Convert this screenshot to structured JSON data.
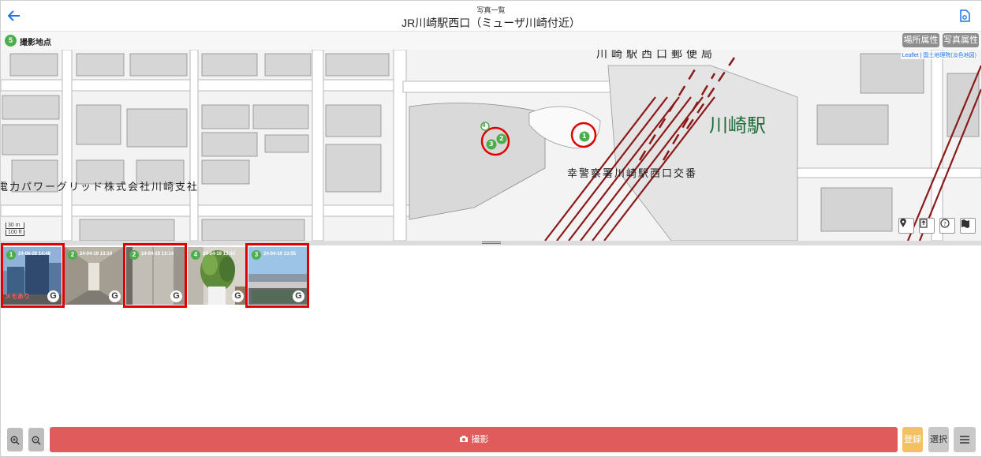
{
  "header": {
    "subtitle": "写真一覧",
    "title": "JR川崎駅西口（ミューザ川崎付近）"
  },
  "subbar": {
    "count": "5",
    "label": "撮影地点",
    "place_attr_label": "場所属性",
    "photo_attr_label": "写真属性"
  },
  "map": {
    "attribution": "Leaflet | 国土地理院(淡色地図)",
    "scale_m": "30 m",
    "scale_ft": "100 ft",
    "labels": {
      "post_office": "川崎駅西口郵便局",
      "station": "川崎駅",
      "police_box": "幸警察署川崎駅西口交番",
      "company": "電力パワーグリッド株式会社川崎支社"
    },
    "markers": {
      "m4": "4",
      "m2": "2",
      "m3": "3",
      "m1": "1"
    },
    "controls": [
      "pin-icon",
      "upload-icon",
      "help-icon",
      "map-icon"
    ]
  },
  "photos": [
    {
      "num": "1",
      "date": "24-06-20 14:46",
      "memo": "メモあり",
      "selected": true
    },
    {
      "num": "2",
      "date": "24-04-19 13:14",
      "memo": "",
      "selected": false
    },
    {
      "num": "2",
      "date": "24-04-19 13:14",
      "memo": "",
      "selected": true
    },
    {
      "num": "4",
      "date": "24-04-19 13:15",
      "memo": "",
      "selected": false
    },
    {
      "num": "3",
      "date": "24-04-19 13:05",
      "memo": "",
      "selected": true
    }
  ],
  "photo_badge": "G",
  "bottom": {
    "zoom_in_icon": "zoom-in-icon",
    "zoom_out_icon": "zoom-out-icon",
    "shoot_label": "撮影",
    "register_label": "登録",
    "select_label": "選択",
    "menu_icon": "menu-icon"
  },
  "colors": {
    "accent": "#1e73e8",
    "marker": "#4cae4c",
    "shoot": "#e05b5b",
    "register": "#f4c064",
    "selection": "#e00000",
    "rail": "#8b1a1a"
  }
}
